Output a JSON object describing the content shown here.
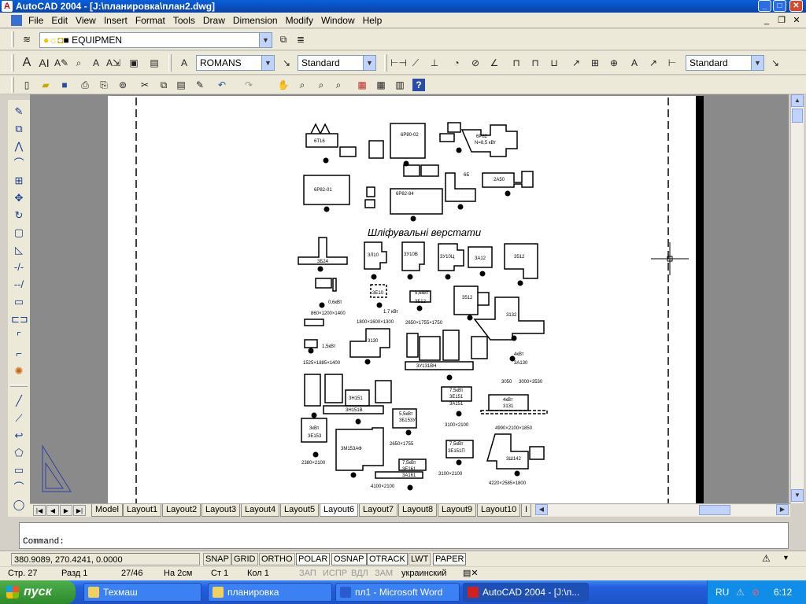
{
  "window": {
    "title": "AutoCAD 2004 - [J:\\планировка\\план2.dwg]",
    "app_icon": "autocad-icon"
  },
  "menu": {
    "items": [
      "File",
      "Edit",
      "View",
      "Insert",
      "Format",
      "Tools",
      "Draw",
      "Dimension",
      "Modify",
      "Window",
      "Help"
    ]
  },
  "layers_toolbar": {
    "layer_value": "EQUIPMEN"
  },
  "styles_toolbar": {
    "font_value": "ROMANS",
    "text_style_value": "Standard",
    "dim_style_value": "Standard"
  },
  "drawing": {
    "heading": "Шліфувальні верстати",
    "labels": [
      "6Т16",
      "6Р80-02",
      "6Р82",
      "N=8,5 кВт",
      "6Р82-01",
      "6Р82-84",
      "6Б",
      "2А50",
      "3Б24",
      "3Л10",
      "3У10В",
      "3У10Ц",
      "3А12",
      "3512",
      "1,5кВт",
      "3Е10",
      "5,6кВт",
      "3Б12",
      "3512",
      "3132",
      "0,6кВт",
      "860×1200×1400",
      "1.7 кВт",
      "1800×1600×1300",
      "2650×1755×1750",
      "3Б12",
      "3130",
      "3У131ВН",
      "4кВт",
      "3А130",
      "1,5кВт",
      "1525×1885×1400",
      "3050",
      "3000×3530",
      "3Н151",
      "3Н151В",
      "7,5кВт",
      "3Е151",
      "3А151",
      "4кВт",
      "3131",
      "5,5кВт",
      "3Б153У",
      "3100×2100",
      "4990×2100×1850",
      "3кВт",
      "3Е153",
      "3М153АФ",
      "2650×1755",
      "2380×2100",
      "7,5кВт",
      "3Е161",
      "3А161",
      "4100×2100",
      "7,5кВт",
      "3Е151П",
      "3100×2100",
      "3Ш142",
      "4220×2585×1800"
    ]
  },
  "layout_tabs": [
    "Model",
    "Layout1",
    "Layout2",
    "Layout3",
    "Layout4",
    "Layout5",
    "Layout6",
    "Layout7",
    "Layout8",
    "Layout9",
    "Layout10",
    "I"
  ],
  "active_tab": "Layout6",
  "command": {
    "prompt": "Command:"
  },
  "status": {
    "coords": "380.9089, 270.4241, 0.0000",
    "buttons": [
      "SNAP",
      "GRID",
      "ORTHO",
      "POLAR",
      "OSNAP",
      "OTRACK",
      "LWT",
      "PAPER"
    ],
    "on_buttons": [
      "POLAR",
      "OSNAP",
      "OTRACK",
      "PAPER"
    ]
  },
  "word_status": {
    "page": "Стр. 27",
    "section": "Разд 1",
    "pages": "27/46",
    "at": "На 2см",
    "line": "Ст 1",
    "col": "Кол 1",
    "rec": "ЗАП",
    "trk": "ИСПР",
    "ext": "ВДЛ",
    "ovr": "ЗАМ",
    "lang": "украинский"
  },
  "taskbar": {
    "start_label": "пуск",
    "tasks": [
      "Техмаш",
      "планировка",
      "пл1 - Microsoft Word",
      "AutoCAD 2004 - [J:\\п..."
    ],
    "active_task": 3,
    "lang": "RU",
    "clock": "6:12"
  }
}
